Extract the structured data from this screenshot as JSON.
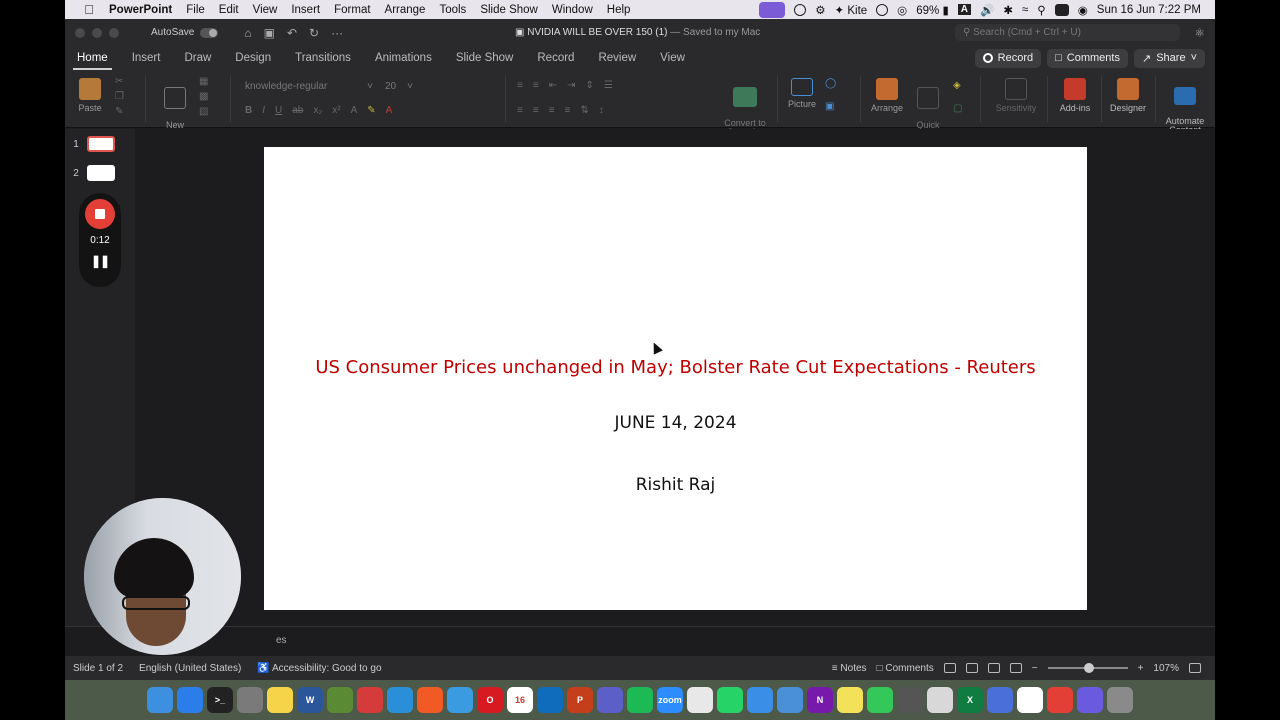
{
  "menubar": {
    "app_name": "PowerPoint",
    "items": [
      "File",
      "Edit",
      "View",
      "Insert",
      "Format",
      "Arrange",
      "Tools",
      "Slide Show",
      "Window",
      "Help"
    ],
    "kite_label": "Kite",
    "battery": "69%",
    "input_source": "A",
    "datetime": "Sun 16 Jun  7:22 PM"
  },
  "titlebar": {
    "autosave_label": "AutoSave",
    "doc_name": "NVIDIA WILL BE OVER 150 (1)",
    "save_status": "— Saved to my Mac",
    "search_placeholder": "Search (Cmd + Ctrl + U)"
  },
  "tabs": [
    "Home",
    "Insert",
    "Draw",
    "Design",
    "Transitions",
    "Animations",
    "Slide Show",
    "Record",
    "Review",
    "View"
  ],
  "tab_actions": {
    "record": "Record",
    "comments": "Comments",
    "share": "Share"
  },
  "ribbon": {
    "paste": "Paste",
    "new_slide": "New\nSlide",
    "font_name": "knowledge-regular",
    "font_size": "20",
    "convert_smartart": "Convert to\nSmartArt",
    "picture": "Picture",
    "arrange": "Arrange",
    "quick_styles": "Quick\nStyles",
    "sensitivity": "Sensitivity",
    "addins": "Add-ins",
    "designer": "Designer",
    "automate": "Automate\nContent"
  },
  "thumbnails": [
    {
      "num": "1",
      "selected": true
    },
    {
      "num": "2",
      "selected": false
    }
  ],
  "recorder": {
    "timer": "0:12"
  },
  "slide": {
    "headline": "US Consumer Prices unchanged in May; Bolster Rate Cut Expectations - Reuters",
    "date": "JUNE 14, 2024",
    "author": "Rishit Raj"
  },
  "notes_partial": "es",
  "statusbar": {
    "slide_info": "Slide 1 of 2",
    "language": "English (United States)",
    "accessibility": "Accessibility: Good to go",
    "notes": "Notes",
    "comments": "Comments",
    "zoom": "107%"
  },
  "colors": {
    "headline": "#c00000",
    "record_button": "#e43f36"
  },
  "dock_apps": [
    {
      "name": "finder",
      "color": "#3d8fe0",
      "label": ""
    },
    {
      "name": "app-store",
      "color": "#2b7de9",
      "label": ""
    },
    {
      "name": "terminal",
      "color": "#222222",
      "label": ">_"
    },
    {
      "name": "system-settings",
      "color": "#7a7a7a",
      "label": ""
    },
    {
      "name": "notes",
      "color": "#f5d44a",
      "label": ""
    },
    {
      "name": "word",
      "color": "#2b579a",
      "label": "W"
    },
    {
      "name": "minecraft",
      "color": "#5a8a34",
      "label": ""
    },
    {
      "name": "wps",
      "color": "#d63b3b",
      "label": ""
    },
    {
      "name": "vscode",
      "color": "#2a8fd8",
      "label": ""
    },
    {
      "name": "brave",
      "color": "#f15a24",
      "label": ""
    },
    {
      "name": "safari",
      "color": "#3a9be0",
      "label": ""
    },
    {
      "name": "opera",
      "color": "#d71a21",
      "label": "O"
    },
    {
      "name": "calendar",
      "color": "#ffffff",
      "label": "16"
    },
    {
      "name": "outlook",
      "color": "#0f6cbd",
      "label": ""
    },
    {
      "name": "powerpoint",
      "color": "#c43e1c",
      "label": "P"
    },
    {
      "name": "teams",
      "color": "#5b5fc7",
      "label": ""
    },
    {
      "name": "spotify",
      "color": "#1db954",
      "label": ""
    },
    {
      "name": "zoom",
      "color": "#2d8cff",
      "label": "zoom"
    },
    {
      "name": "acrobat",
      "color": "#e8e8e8",
      "label": ""
    },
    {
      "name": "whatsapp",
      "color": "#25d366",
      "label": ""
    },
    {
      "name": "mail",
      "color": "#3a8ee6",
      "label": ""
    },
    {
      "name": "preview",
      "color": "#4a90d9",
      "label": ""
    },
    {
      "name": "onenote",
      "color": "#7719aa",
      "label": "N"
    },
    {
      "name": "stickies",
      "color": "#f3e15a",
      "label": ""
    },
    {
      "name": "messages",
      "color": "#34c759",
      "label": ""
    },
    {
      "name": "photo-booth",
      "color": "#555555",
      "label": ""
    },
    {
      "name": "script-editor",
      "color": "#d8d8d8",
      "label": ""
    },
    {
      "name": "excel",
      "color": "#107c41",
      "label": "X"
    },
    {
      "name": "screen-sharing",
      "color": "#4a6fd8",
      "label": ""
    },
    {
      "name": "clock",
      "color": "#ffffff",
      "label": ""
    },
    {
      "name": "recorder",
      "color": "#e43f36",
      "label": ""
    },
    {
      "name": "settings-gear",
      "color": "#6a5adf",
      "label": ""
    },
    {
      "name": "trash",
      "color": "#8a8a8a",
      "label": ""
    }
  ]
}
